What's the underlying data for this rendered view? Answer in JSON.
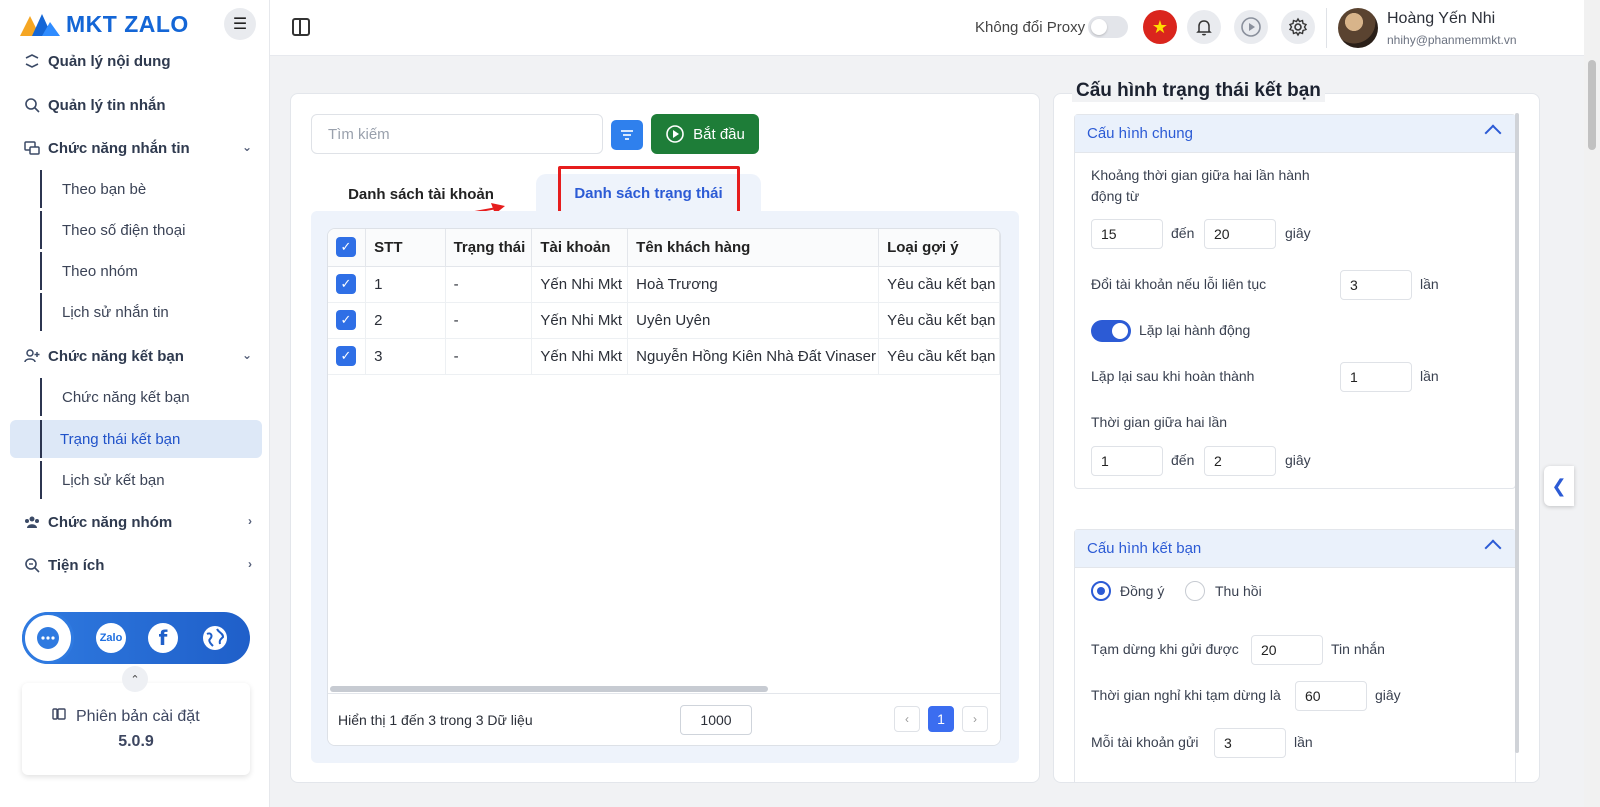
{
  "brand": {
    "name": "MKT ZALO"
  },
  "sidebar": {
    "items": [
      {
        "label": "Quản lý nội dung",
        "icon": "content-icon"
      },
      {
        "label": "Quản lý tin nhắn",
        "icon": "message-search-icon"
      },
      {
        "label": "Chức năng nhắn tin",
        "icon": "chat-icon",
        "expanded": true
      },
      {
        "label": "Chức năng kết bạn",
        "icon": "user-add-icon",
        "expanded": true
      },
      {
        "label": "Chức năng nhóm",
        "icon": "group-icon"
      },
      {
        "label": "Tiện ích",
        "icon": "utility-icon"
      }
    ],
    "messaging_sub": [
      "Theo bạn bè",
      "Theo số điện thoại",
      "Theo nhóm",
      "Lịch sử nhắn tin"
    ],
    "friend_sub": [
      "Chức năng kết bạn",
      "Trạng thái kết bạn",
      "Lịch sử kết bạn"
    ],
    "active_sub": "Trạng thái kết bạn",
    "contact_icons": [
      "support-icon",
      "zalo-icon",
      "facebook-icon",
      "globe-icon"
    ],
    "zalo_text": "Zalo",
    "version": {
      "title": "Phiên bản cài đặt",
      "number": "5.0.9"
    }
  },
  "header": {
    "proxy_label": "Không đổi Proxy",
    "proxy_enabled": false,
    "user": {
      "name": "Hoàng Yến Nhi",
      "email": "nhihy@phanmemmkt.vn"
    }
  },
  "main": {
    "search_placeholder": "Tìm kiếm",
    "start_label": "Bắt đầu",
    "tabs": [
      "Danh sách tài khoản",
      "Danh sách trạng thái"
    ],
    "active_tab": "Danh sách trạng thái",
    "columns": [
      "STT",
      "Trạng thái",
      "Tài khoản",
      "Tên khách hàng",
      "Loại gợi ý"
    ],
    "rows": [
      {
        "stt": "1",
        "status": "-",
        "account": "Yến Nhi Mkt",
        "customer": "Hoà Trương",
        "type": "Yêu cầu kết bạn"
      },
      {
        "stt": "2",
        "status": "-",
        "account": "Yến Nhi Mkt",
        "customer": "Uyên Uyên",
        "type": "Yêu cầu kết bạn"
      },
      {
        "stt": "3",
        "status": "-",
        "account": "Yến Nhi Mkt",
        "customer": "Nguyễn Hồng Kiên Nhà Đất Vinaser",
        "type": "Yêu cầu kết bạn"
      }
    ],
    "footer_text": "Hiển thị 1 đến 3 trong 3 Dữ liệu",
    "page_size": "1000",
    "current_page": "1"
  },
  "config": {
    "title": "Cấu hình trạng thái kết bạn",
    "general": {
      "title": "Cấu hình chung",
      "interval_label": "Khoảng thời gian giữa hai lần hành động từ",
      "interval_from": "15",
      "interval_to": "20",
      "to_word": "đến",
      "seconds_word": "giây",
      "switch_label": "Đổi tài khoản nếu lỗi liên tục",
      "switch_value": "3",
      "times_word": "lần",
      "repeat_label": "Lặp lại hành động",
      "repeat_enabled": true,
      "repeat_after_label": "Lặp lại sau khi hoàn thành",
      "repeat_after_value": "1",
      "between_label": "Thời gian giữa hai lần",
      "between_from": "1",
      "between_to": "2"
    },
    "friend": {
      "title": "Cấu hình kết bạn",
      "option_accept": "Đồng ý",
      "option_revoke": "Thu hồi",
      "selected": "Đồng ý",
      "pause_label": "Tạm dừng khi gửi được",
      "pause_value": "20",
      "pause_unit": "Tin nhắn",
      "rest_label": "Thời gian nghỉ khi tạm dừng là",
      "rest_value": "60",
      "rest_unit": "giây",
      "per_account_label": "Mỗi tài khoản gửi",
      "per_account_value": "3",
      "per_account_unit": "lần"
    }
  }
}
